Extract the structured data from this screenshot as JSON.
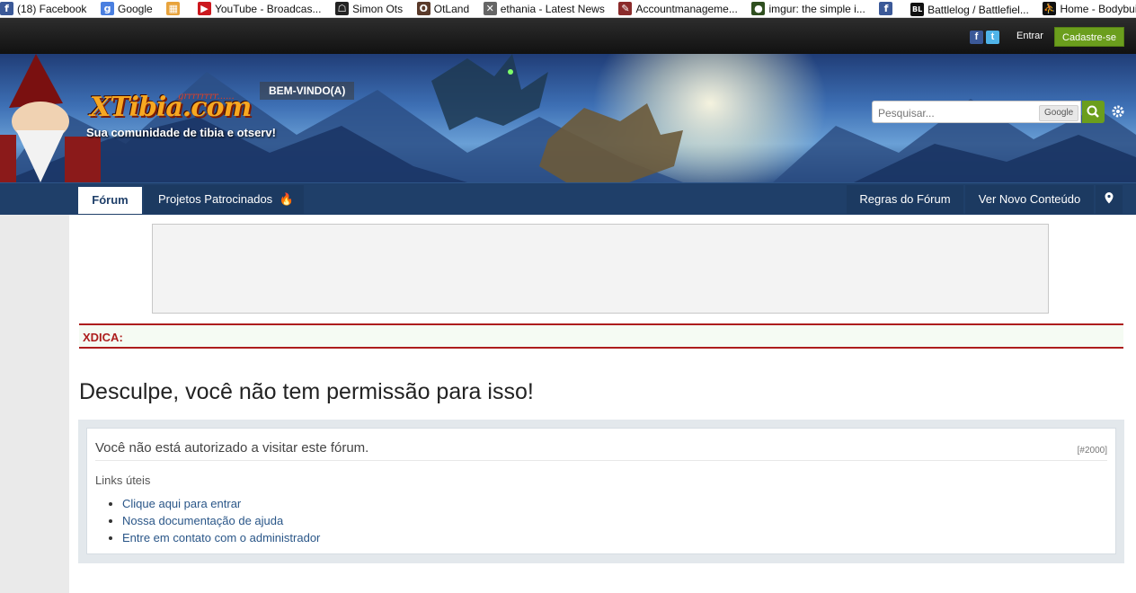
{
  "bookmarks": [
    {
      "label": "(18) Facebook",
      "icon": "facebook-icon",
      "color": "#3b5998",
      "glyph": "f"
    },
    {
      "label": "Google",
      "icon": "google-icon",
      "color": "#4a7fe0",
      "glyph": "g"
    },
    {
      "label": "",
      "icon": "apps-icon",
      "color": "#e8a33c",
      "glyph": "▦"
    },
    {
      "label": "YouTube - Broadcas...",
      "icon": "youtube-icon",
      "color": "#cc181e",
      "glyph": "▶"
    },
    {
      "label": "Simon Ots",
      "icon": "simon-ots-icon",
      "color": "#222222",
      "glyph": "☖"
    },
    {
      "label": "OtLand",
      "icon": "otland-icon",
      "color": "#5a3a2a",
      "glyph": "O"
    },
    {
      "label": "ethania - Latest News",
      "icon": "ethania-icon",
      "color": "#666666",
      "glyph": "✕"
    },
    {
      "label": "Accountmanageme...",
      "icon": "account-icon",
      "color": "#8b2b2b",
      "glyph": "✎"
    },
    {
      "label": "imgur: the simple i...",
      "icon": "imgur-icon",
      "color": "#2f4f1f",
      "glyph": "●"
    },
    {
      "label": "",
      "icon": "facebook-icon",
      "color": "#3b5998",
      "glyph": "f"
    },
    {
      "label": "Battlelog / Battlefiel...",
      "icon": "battlelog-icon",
      "color": "#111111",
      "glyph": "BL"
    },
    {
      "label": "Home - Bodybuildin",
      "icon": "bodybuilding-icon",
      "color": "#111111",
      "glyph": "⛹"
    }
  ],
  "topbar": {
    "login_label": "Entrar",
    "register_label": "Cadastre-se"
  },
  "banner": {
    "logo_text": "XTibia.com",
    "logo_sound": "grrrrrrrr......",
    "tagline": "Sua comunidade de tibia e otserv!",
    "welcome": "BEM-VINDO(A)",
    "search_placeholder": "Pesquisar...",
    "google_label": "Google"
  },
  "nav": {
    "tabs": [
      {
        "label": "Fórum",
        "active": true
      },
      {
        "label": "Projetos Patrocinados",
        "active": false
      }
    ],
    "right_tabs": [
      {
        "label": "Regras do Fórum"
      },
      {
        "label": "Ver Novo Conteúdo"
      }
    ]
  },
  "tip": {
    "label": "XDICA:"
  },
  "error": {
    "title": "Desculpe, você não tem permissão para isso!",
    "message": "Você não está autorizado a visitar este fórum.",
    "code": "[#2000]",
    "links_title": "Links úteis",
    "links": [
      "Clique aqui para entrar",
      "Nossa documentação de ajuda",
      "Entre em contato com o administrador"
    ]
  },
  "colors": {
    "nav_bg": "#1f3f69",
    "accent_green": "#6b9e1d",
    "tip_red": "#ad1d1d",
    "link_blue": "#2a5688"
  }
}
